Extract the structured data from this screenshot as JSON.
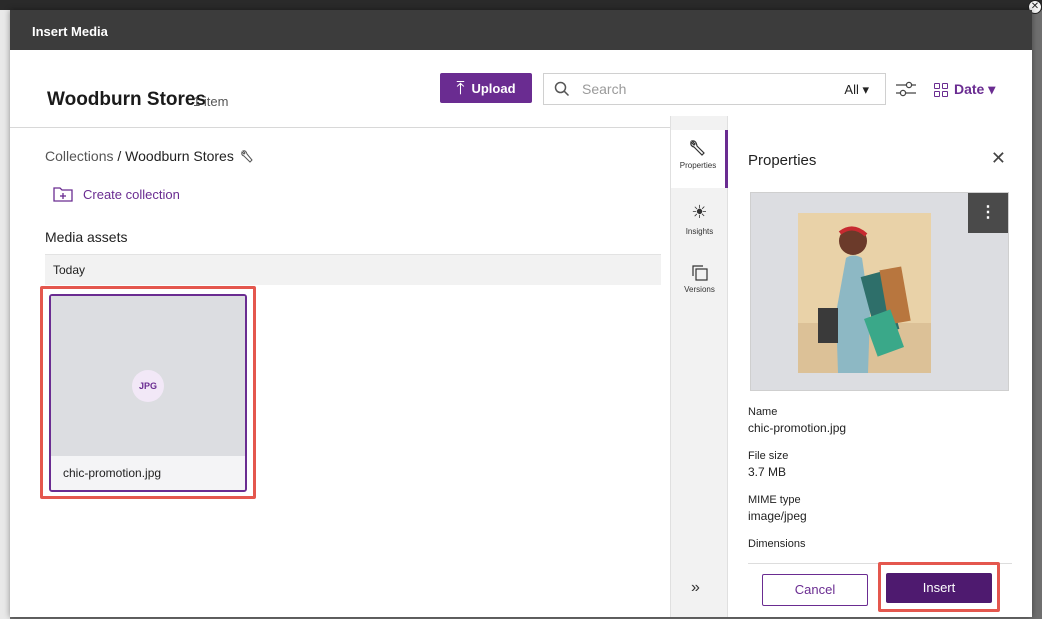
{
  "modal": {
    "title": "Insert Media"
  },
  "header": {
    "collection_title": "Woodburn Stores",
    "item_count": "1 item",
    "upload_label": "Upload",
    "search_placeholder": "Search",
    "filter_value": "All ▾",
    "sort_label": "Date ▾"
  },
  "content": {
    "breadcrumb_root": "Collections",
    "breadcrumb_separator": "/",
    "breadcrumb_current": "Woodburn Stores",
    "create_collection_label": "Create collection",
    "media_assets_label": "Media assets",
    "group_label": "Today",
    "assets": [
      {
        "file_type_badge": "JPG",
        "name": "chic-promotion.jpg"
      }
    ]
  },
  "rail": {
    "items": [
      {
        "label": "Properties",
        "icon": "wrench-icon"
      },
      {
        "label": "Insights",
        "icon": "sun-icon"
      },
      {
        "label": "Versions",
        "icon": "versions-icon"
      }
    ],
    "expand_glyph": "»"
  },
  "properties": {
    "title": "Properties",
    "fields": [
      {
        "label": "Name",
        "value": "chic-promotion.jpg"
      },
      {
        "label": "File size",
        "value": "3.7 MB"
      },
      {
        "label": "MIME type",
        "value": "image/jpeg"
      },
      {
        "label": "Dimensions",
        "value": ""
      }
    ],
    "cancel_label": "Cancel",
    "insert_label": "Insert"
  },
  "colors": {
    "accent": "#6a2c91",
    "insert": "#4e1a6f",
    "highlight": "#e4574e",
    "titlebar": "#3c3c3c"
  }
}
